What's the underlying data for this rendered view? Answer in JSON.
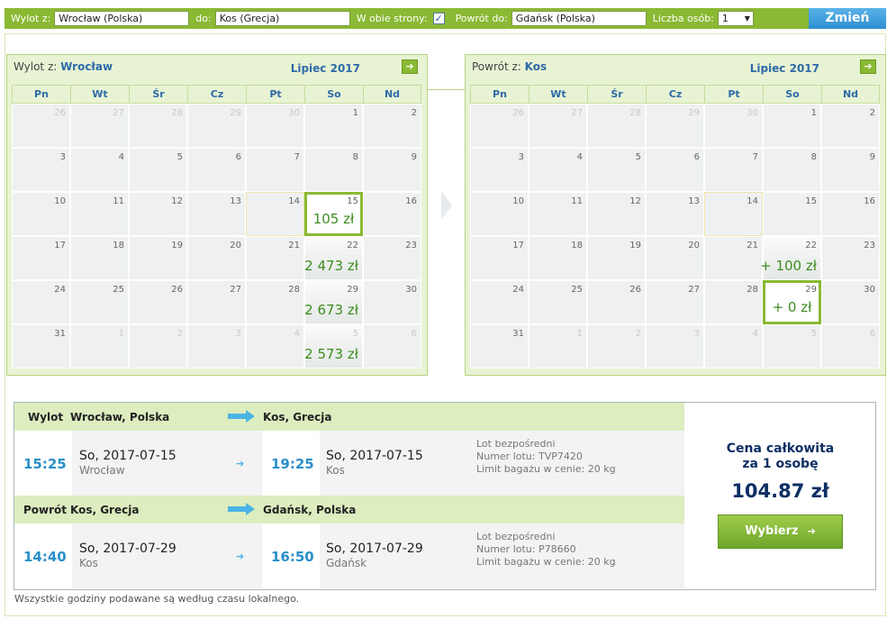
{
  "search": {
    "from_label": "Wylot z:",
    "from_value": "Wrocław (Polska)",
    "to_label": "do:",
    "to_value": "Kos (Grecja)",
    "roundtrip_label": "W obie strony:",
    "roundtrip_checked": "✓",
    "return_label": "Powrót do:",
    "return_value": "Gdańsk (Polska)",
    "persons_label": "Liczba osób:",
    "persons_value": "1",
    "submit_label": "Zmień"
  },
  "outbound_calendar": {
    "title_prefix": "Wylot z:",
    "city": "Wrocław",
    "month": "Lipiec 2017",
    "next_icon": "arrow-right-icon"
  },
  "return_calendar": {
    "title_prefix": "Powrót z:",
    "city": "Kos",
    "month": "Lipiec 2017",
    "next_icon": "arrow-right-icon"
  },
  "weekdays": [
    "Pn",
    "Wt",
    "Śr",
    "Cz",
    "Pt",
    "So",
    "Nd"
  ],
  "outbound_days": [
    {
      "n": "26",
      "o": true
    },
    {
      "n": "27",
      "o": true
    },
    {
      "n": "28",
      "o": true
    },
    {
      "n": "29",
      "o": true
    },
    {
      "n": "30",
      "o": true
    },
    {
      "n": "1"
    },
    {
      "n": "2"
    },
    {
      "n": "3"
    },
    {
      "n": "4"
    },
    {
      "n": "5"
    },
    {
      "n": "6"
    },
    {
      "n": "7"
    },
    {
      "n": "8"
    },
    {
      "n": "9"
    },
    {
      "n": "10"
    },
    {
      "n": "11"
    },
    {
      "n": "12"
    },
    {
      "n": "13"
    },
    {
      "n": "14",
      "hl": true
    },
    {
      "n": "15",
      "p": "105 zł",
      "sel": true
    },
    {
      "n": "16"
    },
    {
      "n": "17"
    },
    {
      "n": "18"
    },
    {
      "n": "19"
    },
    {
      "n": "20"
    },
    {
      "n": "21"
    },
    {
      "n": "22",
      "p": "2 473 zł"
    },
    {
      "n": "23"
    },
    {
      "n": "24"
    },
    {
      "n": "25"
    },
    {
      "n": "26"
    },
    {
      "n": "27"
    },
    {
      "n": "28"
    },
    {
      "n": "29",
      "p": "2 673 zł"
    },
    {
      "n": "30"
    },
    {
      "n": "31"
    },
    {
      "n": "1",
      "o": true
    },
    {
      "n": "2",
      "o": true
    },
    {
      "n": "3",
      "o": true
    },
    {
      "n": "4",
      "o": true
    },
    {
      "n": "5",
      "o": true,
      "p": "2 573 zł"
    },
    {
      "n": "6",
      "o": true
    }
  ],
  "return_days": [
    {
      "n": "26",
      "o": true
    },
    {
      "n": "27",
      "o": true
    },
    {
      "n": "28",
      "o": true
    },
    {
      "n": "29",
      "o": true
    },
    {
      "n": "30",
      "o": true
    },
    {
      "n": "1"
    },
    {
      "n": "2"
    },
    {
      "n": "3"
    },
    {
      "n": "4"
    },
    {
      "n": "5"
    },
    {
      "n": "6"
    },
    {
      "n": "7"
    },
    {
      "n": "8"
    },
    {
      "n": "9"
    },
    {
      "n": "10"
    },
    {
      "n": "11"
    },
    {
      "n": "12"
    },
    {
      "n": "13"
    },
    {
      "n": "14",
      "hl": true
    },
    {
      "n": "15"
    },
    {
      "n": "16"
    },
    {
      "n": "17"
    },
    {
      "n": "18"
    },
    {
      "n": "19"
    },
    {
      "n": "20"
    },
    {
      "n": "21"
    },
    {
      "n": "22",
      "p": "+ 100 zł"
    },
    {
      "n": "23"
    },
    {
      "n": "24"
    },
    {
      "n": "25"
    },
    {
      "n": "26"
    },
    {
      "n": "27"
    },
    {
      "n": "28"
    },
    {
      "n": "29",
      "p": "+ 0 zł",
      "sel": true
    },
    {
      "n": "30"
    },
    {
      "n": "31"
    },
    {
      "n": "1",
      "o": true
    },
    {
      "n": "2",
      "o": true
    },
    {
      "n": "3",
      "o": true
    },
    {
      "n": "4",
      "o": true
    },
    {
      "n": "5",
      "o": true
    },
    {
      "n": "6",
      "o": true
    }
  ],
  "outbound": {
    "label": "Wylot",
    "from": "Wrocław, Polska",
    "to": "Kos, Grecja",
    "dep_time": "15:25",
    "dep_day": "So,",
    "dep_date": "2017-07-15",
    "dep_city": "Wrocław",
    "arr_time": "19:25",
    "arr_day": "So,",
    "arr_date": "2017-07-15",
    "arr_city": "Kos",
    "info_direct": "Lot bezpośredni",
    "info_flight": "Numer lotu: TVP7420",
    "info_baggage": "Limit bagażu w cenie: 20 kg"
  },
  "return": {
    "label": "Powrót",
    "from": "Kos, Grecja",
    "to": "Gdańsk, Polska",
    "dep_time": "14:40",
    "dep_day": "So,",
    "dep_date": "2017-07-29",
    "dep_city": "Kos",
    "arr_time": "16:50",
    "arr_day": "So,",
    "arr_date": "2017-07-29",
    "arr_city": "Gdańsk",
    "info_direct": "Lot bezpośredni",
    "info_flight": "Numer lotu: P78660",
    "info_baggage": "Limit bagażu w cenie: 20 kg"
  },
  "price": {
    "title_line1": "Cena całkowita",
    "title_line2": "za 1 osobę",
    "amount": "104.87 zł",
    "button_label": "Wybierz",
    "button_arrow": "➔"
  },
  "footnote": "Wszystkie godziny podawane są według czasu lokalnego.",
  "colors": {
    "brand_green": "#8ab933",
    "accent_blue": "#2a8fc9",
    "price_green": "#3d8b1f",
    "title_navy": "#0d2f63"
  }
}
